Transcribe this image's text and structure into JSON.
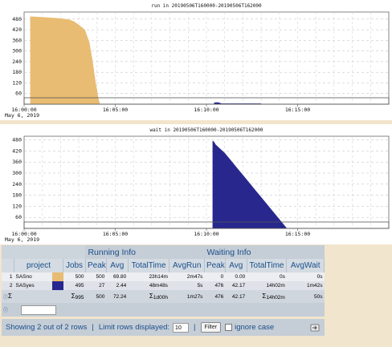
{
  "chart_data": [
    {
      "type": "area",
      "title": "run in 20190506T160000-20190506T162000",
      "yticks": [
        60,
        120,
        180,
        240,
        300,
        360,
        420,
        480
      ],
      "ylim": [
        0,
        520
      ],
      "xlim": [
        0,
        1200
      ],
      "x_tick_positions": [
        0,
        300,
        600,
        900
      ],
      "x_tick_labels": [
        "16:00:00",
        "16:05:00",
        "16:10:00",
        "16:15:00"
      ],
      "date_label": "May 6, 2019",
      "grid": true,
      "series": [
        {
          "name": "SASno",
          "color": "#e8bc72",
          "points": [
            [
              20,
              0
            ],
            [
              20,
              495
            ],
            [
              30,
              494
            ],
            [
              55,
              492
            ],
            [
              80,
              489
            ],
            [
              105,
              486
            ],
            [
              130,
              482
            ],
            [
              150,
              477
            ],
            [
              165,
              466
            ],
            [
              180,
              448
            ],
            [
              200,
              420
            ],
            [
              215,
              350
            ],
            [
              225,
              250
            ],
            [
              235,
              130
            ],
            [
              245,
              30
            ],
            [
              250,
              0
            ]
          ]
        },
        {
          "name": "SASyes",
          "color": "#27278e",
          "points": [
            [
              625,
              0
            ],
            [
              625,
              9
            ],
            [
              630,
              10
            ],
            [
              640,
              10
            ],
            [
              645,
              7
            ],
            [
              650,
              4
            ],
            [
              655,
              4
            ],
            [
              780,
              4
            ],
            [
              780,
              0
            ]
          ]
        }
      ]
    },
    {
      "type": "area",
      "title": "wait in 20190506T160000-20190506T162000",
      "yticks": [
        60,
        120,
        180,
        240,
        300,
        360,
        420,
        480
      ],
      "ylim": [
        0,
        500
      ],
      "xlim": [
        0,
        1200
      ],
      "x_tick_positions": [
        0,
        300,
        600,
        900
      ],
      "x_tick_labels": [
        "16:00:00",
        "16:05:00",
        "16:10:00",
        "16:15:00"
      ],
      "date_label": "May 6, 2019",
      "grid": true,
      "series": [
        {
          "name": "SASyes",
          "color": "#27278e",
          "points": [
            [
              620,
              0
            ],
            [
              620,
              476
            ],
            [
              625,
              470
            ],
            [
              630,
              455
            ],
            [
              640,
              440
            ],
            [
              660,
              410
            ],
            [
              680,
              370
            ],
            [
              700,
              330
            ],
            [
              720,
              290
            ],
            [
              740,
              250
            ],
            [
              760,
              210
            ],
            [
              780,
              170
            ],
            [
              800,
              130
            ],
            [
              820,
              90
            ],
            [
              840,
              50
            ],
            [
              860,
              10
            ],
            [
              865,
              0
            ]
          ]
        }
      ]
    }
  ],
  "table": {
    "group_running": "Running Info",
    "group_waiting": "Waiting Info",
    "columns": {
      "project": "project",
      "jobs": "Jobs",
      "peak": "Peak",
      "avg": "Avg",
      "totaltime": "TotalTime",
      "avgrun": "AvgRun",
      "wpeak": "Peak",
      "wavg": "Avg",
      "wtotaltime": "TotalTime",
      "avgwait": "AvgWait"
    },
    "rows": [
      {
        "idx": "1",
        "project": "SASno",
        "color": "#e8bc72",
        "jobs": "500",
        "peak": "500",
        "avg": "69.80",
        "totaltime": "23h14m",
        "avgrun": "2m47s",
        "wpeak": "0",
        "wavg": "0.00",
        "wtotaltime": "0s",
        "avgwait": "0s"
      },
      {
        "idx": "2",
        "project": "SASyes",
        "color": "#27278e",
        "jobs": "495",
        "peak": "27",
        "avg": "2.44",
        "totaltime": "48m48s",
        "avgrun": "5s",
        "wpeak": "476",
        "wavg": "42.17",
        "wtotaltime": "14h02m",
        "avgwait": "1m42s"
      }
    ],
    "summary": {
      "sigma": "Σ",
      "jobs_sigma": "Σ",
      "jobs": "995",
      "peak": "500",
      "avg": "72.24",
      "totaltime_sigma": "Σ",
      "totaltime": "1d00h",
      "avgrun": "1m27s",
      "wpeak": "476",
      "wavg": "42.17",
      "wtotaltime_sigma": "Σ",
      "wtotaltime": "14h02m",
      "avgwait": "50s"
    }
  },
  "status": {
    "showing": "Showing 2 out of 2 rows",
    "sep": "|",
    "limit_label": "Limit rows displayed:",
    "limit_value": "10",
    "filter_button": "Filter",
    "ignore_case": "ignore case"
  },
  "icons": {
    "help": "question-circle-icon",
    "filter_row": "help-circle-icon",
    "export": "export-icon"
  }
}
